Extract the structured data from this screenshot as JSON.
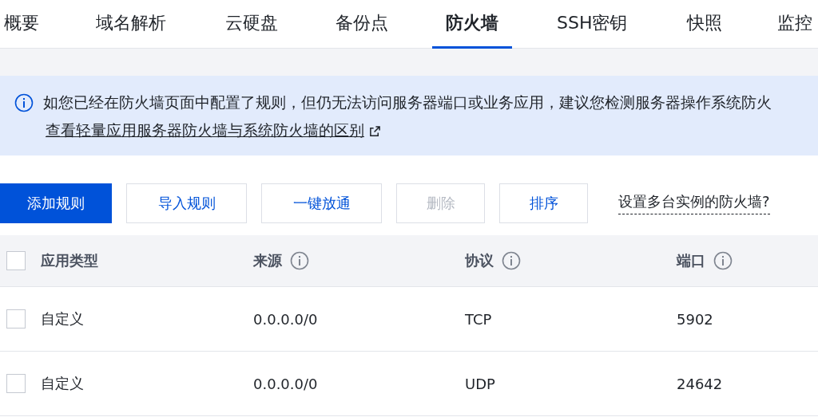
{
  "tabs": [
    {
      "label": "概要",
      "selected": false
    },
    {
      "label": "域名解析",
      "selected": false
    },
    {
      "label": "云硬盘",
      "selected": false
    },
    {
      "label": "备份点",
      "selected": false
    },
    {
      "label": "防火墙",
      "selected": true
    },
    {
      "label": "SSH密钥",
      "selected": false
    },
    {
      "label": "快照",
      "selected": false
    },
    {
      "label": "监控",
      "selected": false
    }
  ],
  "notice": {
    "text": "如您已经在防火墙页面中配置了规则，但仍无法访问服务器端口或业务应用，建议您检测服务器操作系统防火",
    "link": "查看轻量应用服务器防火墙与系统防火墙的区别"
  },
  "toolbar": {
    "buttons": [
      {
        "label": "添加规则",
        "kind": "primary",
        "disabled": false
      },
      {
        "label": "导入规则",
        "kind": "default",
        "disabled": false
      },
      {
        "label": "一键放通",
        "kind": "default",
        "disabled": false
      },
      {
        "label": "删除",
        "kind": "default",
        "disabled": true
      },
      {
        "label": "排序",
        "kind": "default",
        "disabled": false
      }
    ],
    "help_link": "设置多台实例的防火墙?"
  },
  "table": {
    "select_all_checked": false,
    "columns": [
      {
        "label": "应用类型",
        "info": false
      },
      {
        "label": "来源",
        "info": true
      },
      {
        "label": "协议",
        "info": true
      },
      {
        "label": "端口",
        "info": true
      }
    ],
    "rows": [
      {
        "checked": false,
        "cells": [
          "自定义",
          "0.0.0.0/0",
          "TCP",
          "5902"
        ]
      },
      {
        "checked": false,
        "cells": [
          "自定义",
          "0.0.0.0/0",
          "UDP",
          "24642"
        ]
      }
    ]
  }
}
